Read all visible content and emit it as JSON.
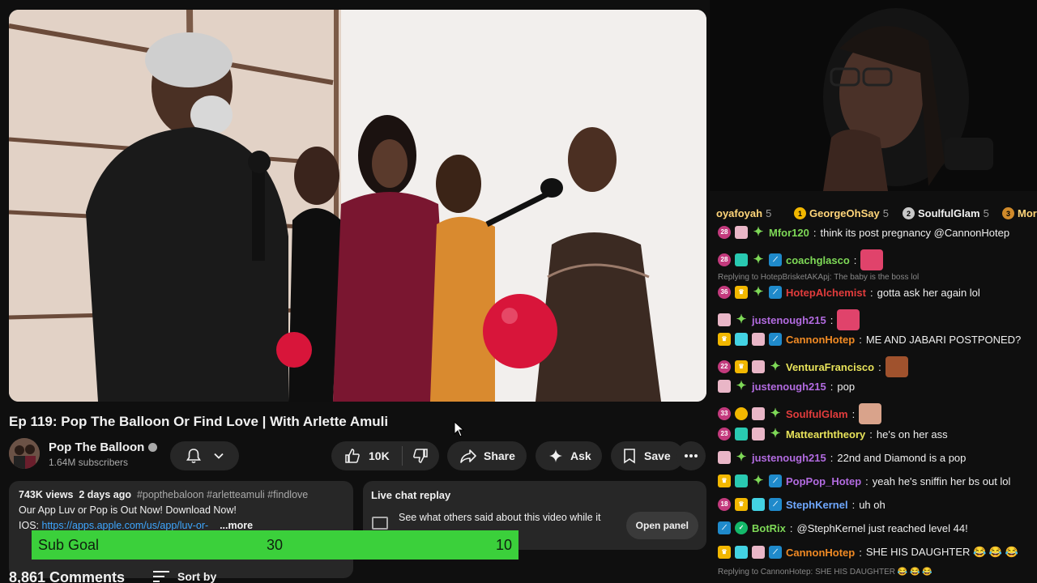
{
  "video": {
    "title": "Ep 119: Pop The Balloon Or Find Love | With Arlette Amuli"
  },
  "channel": {
    "name": "Pop The Balloon",
    "subscribers": "1.64M subscribers"
  },
  "actions": {
    "likes": "10K",
    "share": "Share",
    "ask": "Ask",
    "save": "Save"
  },
  "description": {
    "views": "743K views",
    "date": "2 days ago",
    "tags": "#popthebaloon #arletteamuli #findlove",
    "line1": "Our App Luv or Pop is Out Now! Download Now!",
    "ios_label": "IOS:",
    "ios_link": "https://apps.apple.com/us/app/luv-or-",
    "more": "...more"
  },
  "live_chat": {
    "heading": "Live chat replay",
    "text": "See what others said about this video while it",
    "button": "Open panel"
  },
  "comments": {
    "count": "8,861 Comments",
    "sort": "Sort by"
  },
  "sub_goal": {
    "label": "Sub Goal",
    "current": "30",
    "target": "10"
  },
  "leaderboard": [
    {
      "name": "oyafoyah",
      "count": "5",
      "rank": ""
    },
    {
      "name": "GeorgeOhSay",
      "count": "5",
      "rank": "1"
    },
    {
      "name": "SoulfulGlam",
      "count": "5",
      "rank": "2"
    },
    {
      "name": "Mor",
      "count": "",
      "rank": "3"
    }
  ],
  "chat": [
    {
      "user": "Mfor120",
      "color": "#7ed957",
      "text": "think its post pregnancy @CannonHotep",
      "badges": [
        "sub:28",
        "gift",
        "star"
      ]
    },
    {
      "user": "coachglasco",
      "color": "#7ed957",
      "text": "",
      "badges": [
        "sub:28",
        "teal",
        "star",
        "prime"
      ],
      "emote": "#e0436b"
    },
    {
      "reply": "Replying to HotepBrisketAKApj: The baby is the boss lol"
    },
    {
      "user": "HotepAlchemist",
      "color": "#e23c3c",
      "text": "gotta ask her again lol",
      "badges": [
        "sub:36",
        "crown",
        "star",
        "prime"
      ]
    },
    {
      "user": "justenough215",
      "color": "#b26be0",
      "text": "",
      "badges": [
        "gift",
        "star"
      ],
      "emote": "#e0436b"
    },
    {
      "user": "CannonHotep",
      "color": "#f08a24",
      "text": "ME AND JABARI POSTPONED?",
      "badges": [
        "crown",
        "cyan",
        "gift",
        "prime"
      ]
    },
    {
      "user": "VenturaFrancisco",
      "color": "#e8e35a",
      "text": "",
      "badges": [
        "sub:22",
        "crown",
        "gift",
        "star"
      ],
      "emote": "#a0522d"
    },
    {
      "user": "justenough215",
      "color": "#b26be0",
      "text": "pop",
      "badges": [
        "gift",
        "star"
      ]
    },
    {
      "user": "SoulfulGlam",
      "color": "#e23c3c",
      "text": "",
      "badges": [
        "sub:33",
        "coin",
        "gift",
        "star"
      ],
      "emote": "#d9a38b"
    },
    {
      "user": "Mattearththeory",
      "color": "#e8e35a",
      "text": "he's on her ass",
      "badges": [
        "sub:23",
        "teal",
        "gift",
        "star"
      ]
    },
    {
      "user": "justenough215",
      "color": "#b26be0",
      "text": "22nd and Diamond is a pop",
      "badges": [
        "gift",
        "star"
      ]
    },
    {
      "user": "PopPop_Hotep",
      "color": "#b26be0",
      "text": "yeah he's sniffin her bs out lol",
      "badges": [
        "crown",
        "teal",
        "star",
        "prime"
      ]
    },
    {
      "user": "StephKernel",
      "color": "#6fa8ff",
      "text": "uh oh",
      "badges": [
        "sub:18",
        "crown",
        "cyan",
        "prime"
      ]
    },
    {
      "user": "BotRix",
      "color": "#7ed957",
      "text": "@StephKernel just reached level 44!",
      "badges": [
        "prime",
        "check"
      ]
    },
    {
      "user": "CannonHotep",
      "color": "#f08a24",
      "text": "SHE HIS DAUGHTER 😂 😂 😂",
      "badges": [
        "crown",
        "cyan",
        "gift",
        "prime"
      ]
    },
    {
      "reply": "Replying to CannonHotep: SHE HIS DAUGHTER 😂 😂 😂"
    }
  ]
}
